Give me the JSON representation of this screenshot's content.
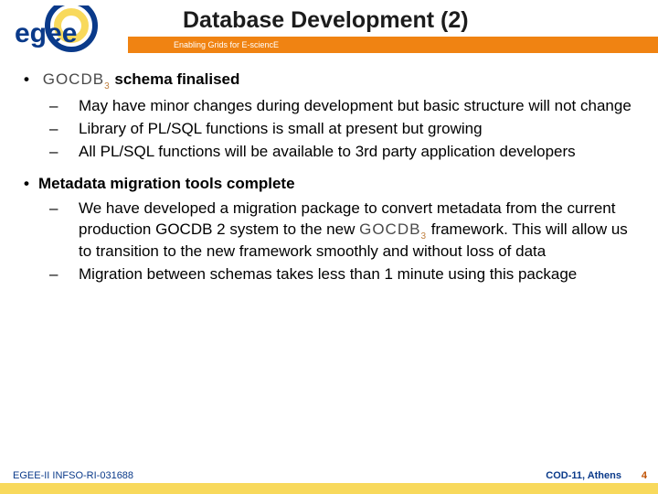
{
  "header": {
    "title": "Database Development (2)",
    "subtitle": "Enabling Grids for E-sciencE",
    "logo_text": "egee"
  },
  "bullets": [
    {
      "heading_prefix": "GOCDB",
      "heading_sub": "3",
      "heading_after": " schema finalised",
      "subs": [
        "May have minor changes during development but basic structure will not change",
        "Library of PL/SQL functions is small at present but growing",
        "All PL/SQL functions will be available to 3rd party application developers"
      ]
    },
    {
      "heading_plain": "Metadata migration tools complete",
      "subs": [
        {
          "pre": "We have developed a migration package to convert metadata from the current production GOCDB 2 system to the new ",
          "gocdb": "GOCDB",
          "gocdb_sub": "3",
          "post": " framework.  This will allow us to transition to the new framework smoothly and without loss of data"
        },
        "Migration between schemas takes less than 1 minute using this package"
      ]
    }
  ],
  "footer": {
    "left": "EGEE-II INFSO-RI-031688",
    "right": "COD-11, Athens",
    "page": "4"
  }
}
